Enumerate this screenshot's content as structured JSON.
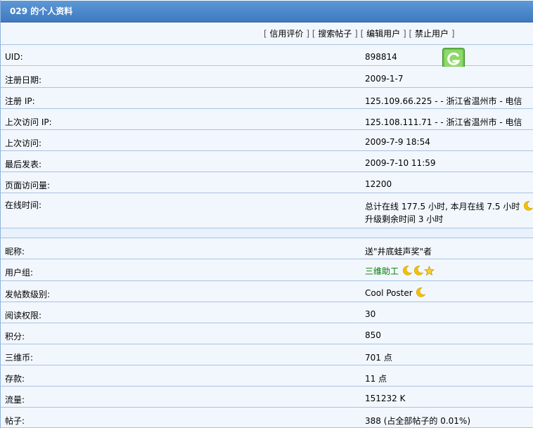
{
  "title": "029 的个人资料",
  "actions": [
    "信用评价",
    "搜索帖子",
    "编辑用户",
    "禁止用户"
  ],
  "badge_icon": "g-logo-icon",
  "rows": [
    {
      "label": "UID:",
      "value": "898814"
    },
    {
      "label": "注册日期:",
      "value": "2009-1-7"
    },
    {
      "label": "注册  IP:",
      "value": "125.109.66.225 - - 浙江省温州市  - 电信"
    },
    {
      "label": "上次访问  IP:",
      "value": "125.108.111.71 - - 浙江省温州市  - 电信"
    },
    {
      "label": "上次访问:",
      "value": "2009-7-9 18:54"
    },
    {
      "label": "最后发表:",
      "value": "2009-7-10 11:59"
    },
    {
      "label": "页面访问量:",
      "value": "12200"
    },
    {
      "label": "在线时间:",
      "value": "总计在线  177.5 小时, 本月在线  7.5 小时",
      "value2": "升级剩余时间  3 小时"
    },
    {
      "label": "昵称:",
      "value": "送\"井底蛙声奖\"者"
    },
    {
      "label": "用户组:",
      "value": "三维助工"
    },
    {
      "label": "发帖数级别:",
      "value": "Cool Poster"
    },
    {
      "label": "阅读权限:",
      "value": "30"
    },
    {
      "label": "积分:",
      "value": "850"
    },
    {
      "label": "三维币:",
      "value": "701 点"
    },
    {
      "label": "存款:",
      "value": "11 点"
    },
    {
      "label": "流量:",
      "value": "151232 K"
    },
    {
      "label": "帖子:",
      "value": "388 (占全部帖子的  0.01%)"
    }
  ],
  "colors": {
    "header": "#4a86c8",
    "row_bg": "#f2f7fd",
    "border": "#a7c3e2",
    "group_text": "#007a00",
    "moon": "#f2c200"
  }
}
